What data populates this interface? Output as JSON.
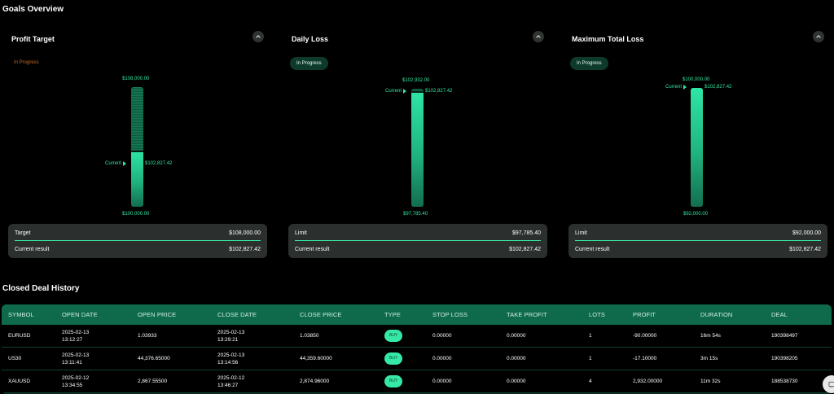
{
  "goals_overview": {
    "title": "Goals Overview",
    "cards": [
      {
        "title": "Profit Target",
        "status": "In Progress",
        "status_style": "plain",
        "top_label": "$108,000.00",
        "bottom_label": "$100,000.00",
        "current_label": "Current",
        "current_value": "$102,827.42",
        "fill_fraction": 0.353,
        "summary": [
          {
            "label": "Target",
            "value": "$108,000.00"
          },
          {
            "label": "Current result",
            "value": "$102,827.42"
          }
        ]
      },
      {
        "title": "Daily Loss",
        "status": "In Progress",
        "status_style": "pill",
        "top_label": "$102,932.00",
        "bottom_label": "$97,785.40",
        "current_label": "Current",
        "current_value": "$102,827.42",
        "fill_fraction": 0.98,
        "summary": [
          {
            "label": "Limit",
            "value": "$97,785.40"
          },
          {
            "label": "Current result",
            "value": "$102,827.42"
          }
        ]
      },
      {
        "title": "Maximum Total Loss",
        "status": "In Progress",
        "status_style": "pill",
        "top_label": "$100,000.00",
        "bottom_label": "$92,000.00",
        "current_label": "Current",
        "current_value": "$102,827.42",
        "fill_fraction": 1.0,
        "summary": [
          {
            "label": "Limit",
            "value": "$92,000.00"
          },
          {
            "label": "Current result",
            "value": "$102,827.42"
          }
        ]
      }
    ]
  },
  "deal_history": {
    "title": "Closed Deal History",
    "columns": [
      "SYMBOL",
      "OPEN DATE",
      "OPEN PRICE",
      "CLOSE DATE",
      "CLOSE PRICE",
      "TYPE",
      "STOP LOSS",
      "TAKE PROFIT",
      "LOTS",
      "PROFIT",
      "DURATION",
      "DEAL"
    ],
    "rows": [
      {
        "symbol": "EURUSD",
        "open_date": "2025-02-13",
        "open_time": "13:12:27",
        "open_price": "1.03933",
        "close_date": "2025-02-13",
        "close_time": "13:29:21",
        "close_price": "1.03850",
        "type": "BUY",
        "stop_loss": "0.00000",
        "take_profit": "0.00000",
        "lots": "1",
        "profit": "-90.00000",
        "duration": "16m 54s",
        "deal": "190398497"
      },
      {
        "symbol": "US30",
        "open_date": "2025-02-13",
        "open_time": "13:11:41",
        "open_price": "44,376.65000",
        "close_date": "2025-02-13",
        "close_time": "13:14:56",
        "close_price": "44,359.60000",
        "type": "BUY",
        "stop_loss": "0.00000",
        "take_profit": "0.00000",
        "lots": "1",
        "profit": "-17.10000",
        "duration": "3m 15s",
        "deal": "190398205"
      },
      {
        "symbol": "XAUUSD",
        "open_date": "2025-02-12",
        "open_time": "13:34:55",
        "open_price": "2,867.55500",
        "close_date": "2025-02-12",
        "close_time": "13:46:27",
        "close_price": "2,874.96000",
        "type": "BUY",
        "stop_loss": "0.00000",
        "take_profit": "0.00000",
        "lots": "4",
        "profit": "2,932.00000",
        "duration": "11m 32s",
        "deal": "188538730"
      }
    ]
  },
  "icons": {
    "collapse": "chevron-up-icon",
    "chat": "chat-icon"
  },
  "colors": {
    "accent": "#35e6a0",
    "header_bg": "#0f6a4b",
    "card_bg": "#2b2f2d",
    "status_orange": "#c46a2a"
  }
}
